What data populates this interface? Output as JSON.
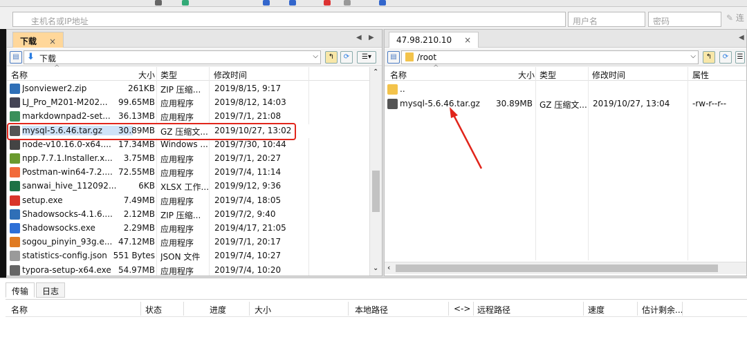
{
  "connection": {
    "host_placeholder": "主机名或IP地址",
    "user_placeholder": "用户名",
    "pass_placeholder": "密码",
    "connect_label": "连"
  },
  "local": {
    "tab_label": "下载",
    "path": "下载",
    "columns": [
      "名称",
      "大小",
      "类型",
      "修改时间"
    ],
    "files": [
      {
        "name": "Jsonviewer2.zip",
        "size": "261KB",
        "type": "ZIP 压缩...",
        "mtime": "2019/8/15, 9:17",
        "icon": "zip-icon",
        "color": "#2f6fb7"
      },
      {
        "name": "LJ_Pro_M201-M202...",
        "size": "99.65MB",
        "type": "应用程序",
        "mtime": "2019/8/12, 14:03",
        "icon": "printer-icon",
        "color": "#445"
      },
      {
        "name": "markdownpad2-set...",
        "size": "36.13MB",
        "type": "应用程序",
        "mtime": "2019/7/1, 21:08",
        "icon": "installer-icon",
        "color": "#3a8f5a"
      },
      {
        "name": "mysql-5.6.46.tar.gz",
        "size": "30.89MB",
        "type": "GZ 压缩文...",
        "mtime": "2019/10/27, 13:02",
        "icon": "gz-archive-icon",
        "color": "#555"
      },
      {
        "name": "node-v10.16.0-x64....",
        "size": "17.34MB",
        "type": "Windows ...",
        "mtime": "2019/7/30, 10:44",
        "icon": "msi-icon",
        "color": "#444"
      },
      {
        "name": "npp.7.7.1.Installer.x...",
        "size": "3.75MB",
        "type": "应用程序",
        "mtime": "2019/7/1, 20:27",
        "icon": "notepadpp-icon",
        "color": "#6a9a2e"
      },
      {
        "name": "Postman-win64-7.2....",
        "size": "72.55MB",
        "type": "应用程序",
        "mtime": "2019/7/4, 11:14",
        "icon": "postman-icon",
        "color": "#f26b3a"
      },
      {
        "name": "sanwai_hive_112092...",
        "size": "6KB",
        "type": "XLSX 工作...",
        "mtime": "2019/9/12, 9:36",
        "icon": "excel-icon",
        "color": "#1e7145"
      },
      {
        "name": "setup.exe",
        "size": "7.49MB",
        "type": "应用程序",
        "mtime": "2019/7/4, 18:05",
        "icon": "setup-icon",
        "color": "#d9352b"
      },
      {
        "name": "Shadowsocks-4.1.6....",
        "size": "2.12MB",
        "type": "ZIP 压缩...",
        "mtime": "2019/7/2, 9:40",
        "icon": "zip-icon",
        "color": "#2f6fb7"
      },
      {
        "name": "Shadowsocks.exe",
        "size": "2.29MB",
        "type": "应用程序",
        "mtime": "2019/4/17, 21:05",
        "icon": "paper-plane-icon",
        "color": "#2d6fd6"
      },
      {
        "name": "sogou_pinyin_93g.e...",
        "size": "47.12MB",
        "type": "应用程序",
        "mtime": "2019/7/1, 20:17",
        "icon": "sogou-icon",
        "color": "#e07b22"
      },
      {
        "name": "statistics-config.json",
        "size": "551 Bytes",
        "type": "JSON 文件",
        "mtime": "2019/7/4, 10:27",
        "icon": "file-icon",
        "color": "#9a9a9a"
      },
      {
        "name": "typora-setup-x64.exe",
        "size": "54.97MB",
        "type": "应用程序",
        "mtime": "2019/7/4, 10:20",
        "icon": "typora-icon",
        "color": "#666"
      }
    ]
  },
  "remote": {
    "tab_label": "47.98.210.10",
    "path": "/root",
    "columns": [
      "名称",
      "大小",
      "类型",
      "修改时间",
      "属性"
    ],
    "files": [
      {
        "name": "..",
        "size": "",
        "type": "",
        "mtime": "",
        "attr": "",
        "icon": "folder-icon",
        "color": "#f3c34b"
      },
      {
        "name": "mysql-5.6.46.tar.gz",
        "size": "30.89MB",
        "type": "GZ 压缩文...",
        "mtime": "2019/10/27, 13:04",
        "attr": "-rw-r--r--",
        "icon": "gz-archive-icon",
        "color": "#555"
      }
    ]
  },
  "transfer": {
    "tabs": [
      "传输",
      "日志"
    ],
    "columns": [
      "名称",
      "状态",
      "进度",
      "大小",
      "本地路径",
      "<->",
      "远程路径",
      "速度",
      "估计剩余..."
    ]
  },
  "colors": {
    "highlight": "#e1251b",
    "local_tab": "#ffd79a"
  }
}
